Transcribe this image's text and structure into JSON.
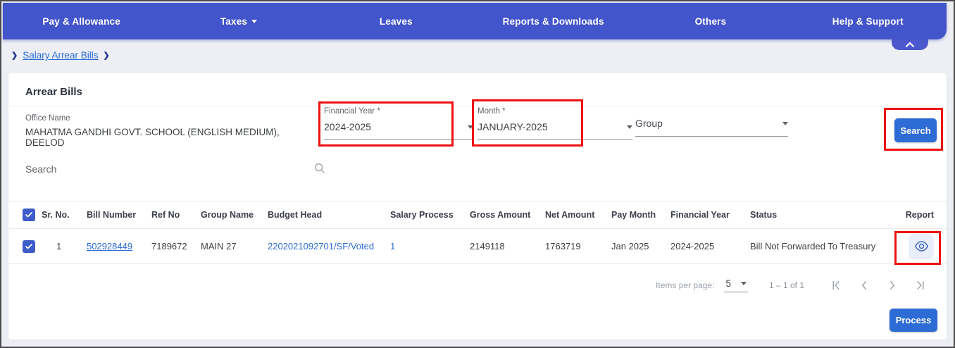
{
  "colors": {
    "nav_blue": "#4355cb",
    "button_blue": "#2d6bd5",
    "link_blue": "#2b6cd4",
    "highlight_red": "#ee1111",
    "checkbox_blue": "#3d5cc9"
  },
  "nav": {
    "items": [
      "Pay & Allowance",
      "Taxes",
      "Leaves",
      "Reports & Downloads",
      "Others",
      "Help & Support"
    ]
  },
  "breadcrumb": {
    "chevron": "❯",
    "link_label": "Salary Arrear Bills"
  },
  "page": {
    "title": "Arrear Bills"
  },
  "filters": {
    "office_name": {
      "label": "Office Name",
      "value": "MAHATMA GANDHI GOVT. SCHOOL (ENGLISH MEDIUM), DEELOD"
    },
    "financial_year": {
      "label": "Financial Year *",
      "value": "2024-2025"
    },
    "month": {
      "label": "Month *",
      "value": "JANUARY-2025"
    },
    "group": {
      "placeholder": "Group"
    },
    "search_button_label": "Search"
  },
  "table_search": {
    "placeholder": "Search"
  },
  "table": {
    "headers": [
      "Sr. No.",
      "Bill Number",
      "Ref No",
      "Group Name",
      "Budget Head",
      "Salary Process",
      "Gross Amount",
      "Net Amount",
      "Pay Month",
      "Financial Year",
      "Status",
      "Report"
    ],
    "rows": [
      {
        "sr_no": "1",
        "bill_number": "502928449",
        "ref_no": "7189672",
        "group_name": "MAIN 27",
        "budget_head": "2202021092701/SF/Voted",
        "salary_process": "1",
        "gross_amount": "2149118",
        "net_amount": "1763719",
        "pay_month": "Jan 2025",
        "financial_year": "2024-2025",
        "status": "Bill Not Forwarded To Treasury"
      }
    ]
  },
  "pagination": {
    "items_per_page_label": "Items per page:",
    "items_per_page_value": "5",
    "range": "1 – 1 of 1"
  },
  "actions": {
    "process_button_label": "Process"
  }
}
